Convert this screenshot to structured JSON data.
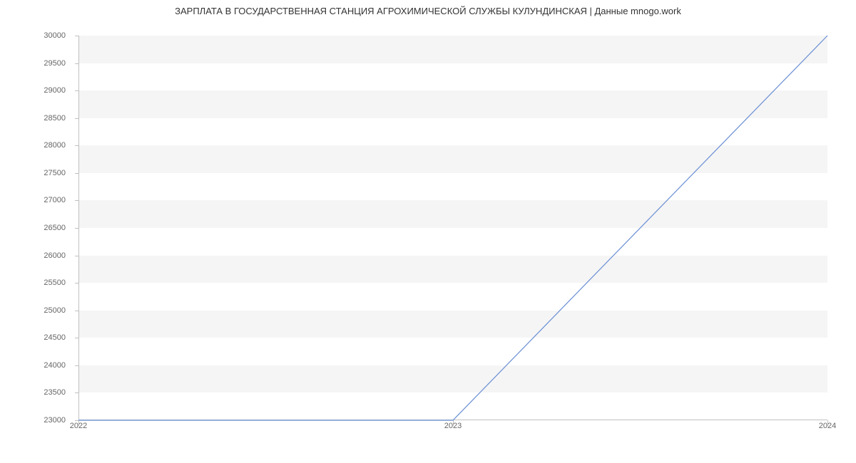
{
  "chart_data": {
    "type": "line",
    "title": "ЗАРПЛАТА В  ГОСУДАРСТВЕННАЯ СТАНЦИЯ АГРОХИМИЧЕСКОЙ СЛУЖБЫ КУЛУНДИНСКАЯ | Данные mnogo.work",
    "x": [
      2022,
      2023,
      2024
    ],
    "values": [
      23000,
      23000,
      30000
    ],
    "xlabel": "",
    "ylabel": "",
    "x_ticks": [
      "2022",
      "2023",
      "2024"
    ],
    "y_ticks": [
      "23000",
      "23500",
      "24000",
      "24500",
      "25000",
      "25500",
      "26000",
      "26500",
      "27000",
      "27500",
      "28000",
      "28500",
      "29000",
      "29500",
      "30000"
    ],
    "ylim": [
      23000,
      30000
    ],
    "xlim": [
      2022,
      2024
    ],
    "series_color": "#6a8fd4"
  }
}
